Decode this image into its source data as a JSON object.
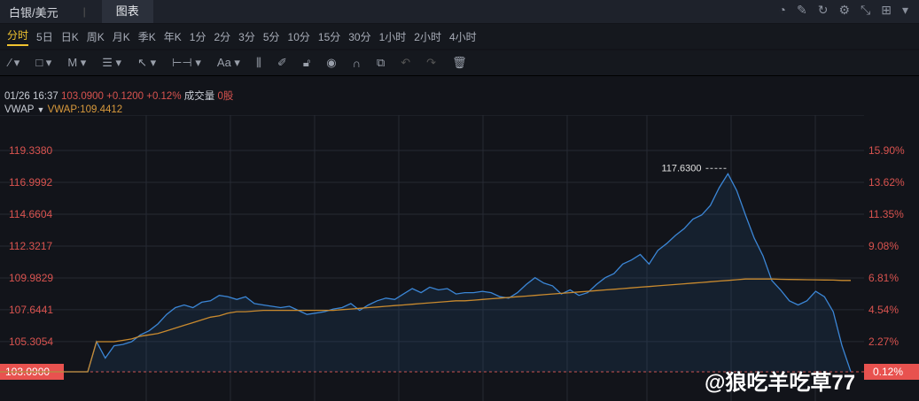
{
  "header": {
    "symbol": "白银/美元",
    "tab": "图表",
    "icons": [
      "speedometer-icon",
      "edit-icon",
      "refresh-icon",
      "gear-icon",
      "collapse-icon",
      "grid-icon"
    ]
  },
  "periods": [
    "分时",
    "5日",
    "日K",
    "周K",
    "月K",
    "季K",
    "年K",
    "1分",
    "2分",
    "3分",
    "5分",
    "10分",
    "15分",
    "30分",
    "1小时",
    "2小时",
    "4小时"
  ],
  "tools": [
    "line-icon",
    "rect-icon",
    "pattern-icon",
    "fib-icon",
    "arrow-icon",
    "measure-icon",
    "text-icon",
    "candle-icon",
    "pen-icon",
    "lock-icon",
    "eye-icon",
    "magnet-icon",
    "layers-icon",
    "undo-icon",
    "redo-icon",
    "trash-icon"
  ],
  "info": {
    "time": "01/26 16:37",
    "price": "103.0900",
    "change": "+0.1200",
    "pct": "+0.12%",
    "vol_label": "成交量",
    "vol": "0股"
  },
  "indicator": {
    "name": "VWAP",
    "value": "VWAP:109.4412"
  },
  "watermark": "@狼吃羊吃草77",
  "chart_data": {
    "type": "line",
    "yticks": [
      "119.3380",
      "116.9992",
      "114.6604",
      "112.3217",
      "109.9829",
      "107.6441",
      "105.3054",
      "103.0900"
    ],
    "ytick_values": [
      119.338,
      116.9992,
      114.6604,
      112.3217,
      109.9829,
      107.6441,
      105.3054,
      103.09
    ],
    "pct_ticks": [
      "15.90%",
      "13.62%",
      "11.35%",
      "9.08%",
      "6.81%",
      "4.54%",
      "2.27%",
      "0.12%"
    ],
    "ylim": [
      103.09,
      119.338
    ],
    "peak_label": "117.6300",
    "peak": 117.63,
    "last": 103.09,
    "price": [
      103.09,
      103.09,
      103.09,
      103.09,
      103.09,
      103.09,
      103.09,
      103.09,
      103.09,
      103.09,
      103.09,
      105.3,
      104.1,
      105.0,
      105.1,
      105.3,
      105.8,
      106.1,
      106.6,
      107.3,
      107.8,
      108.0,
      107.8,
      108.2,
      108.3,
      108.7,
      108.6,
      108.4,
      108.6,
      108.1,
      108.0,
      107.9,
      107.8,
      107.9,
      107.6,
      107.3,
      107.4,
      107.5,
      107.7,
      107.8,
      108.1,
      107.6,
      108.0,
      108.3,
      108.5,
      108.4,
      108.8,
      109.2,
      108.9,
      109.3,
      109.1,
      109.2,
      108.8,
      108.9,
      108.9,
      109.0,
      108.9,
      108.6,
      108.5,
      108.9,
      109.5,
      110.0,
      109.6,
      109.4,
      108.8,
      109.1,
      108.7,
      108.9,
      109.5,
      110.0,
      110.3,
      111.0,
      111.3,
      111.7,
      111.0,
      112.0,
      112.5,
      113.1,
      113.6,
      114.3,
      114.6,
      115.3,
      116.6,
      117.63,
      116.4,
      114.6,
      112.9,
      111.6,
      109.8,
      109.1,
      108.3,
      108.0,
      108.3,
      109.0,
      108.6,
      107.5,
      105.0,
      103.1
    ],
    "vwap": [
      103.09,
      103.09,
      103.09,
      103.09,
      103.09,
      103.09,
      103.09,
      103.09,
      103.09,
      103.09,
      103.09,
      105.3,
      105.3,
      105.3,
      105.4,
      105.5,
      105.7,
      105.8,
      105.9,
      106.1,
      106.3,
      106.5,
      106.7,
      106.9,
      107.1,
      107.2,
      107.4,
      107.5,
      107.5,
      107.55,
      107.6,
      107.6,
      107.6,
      107.6,
      107.6,
      107.6,
      107.6,
      107.6,
      107.6,
      107.65,
      107.7,
      107.75,
      107.8,
      107.85,
      107.9,
      107.95,
      108.0,
      108.05,
      108.1,
      108.15,
      108.2,
      108.25,
      108.3,
      108.3,
      108.35,
      108.4,
      108.45,
      108.5,
      108.55,
      108.6,
      108.65,
      108.7,
      108.75,
      108.8,
      108.85,
      108.9,
      108.95,
      109.0,
      109.05,
      109.1,
      109.15,
      109.2,
      109.25,
      109.3,
      109.35,
      109.4,
      109.45,
      109.5,
      109.55,
      109.6,
      109.65,
      109.7,
      109.75,
      109.8,
      109.85,
      109.9,
      109.9,
      109.9,
      109.9,
      109.88,
      109.87,
      109.86,
      109.85,
      109.84,
      109.83,
      109.82,
      109.8,
      109.8
    ]
  }
}
